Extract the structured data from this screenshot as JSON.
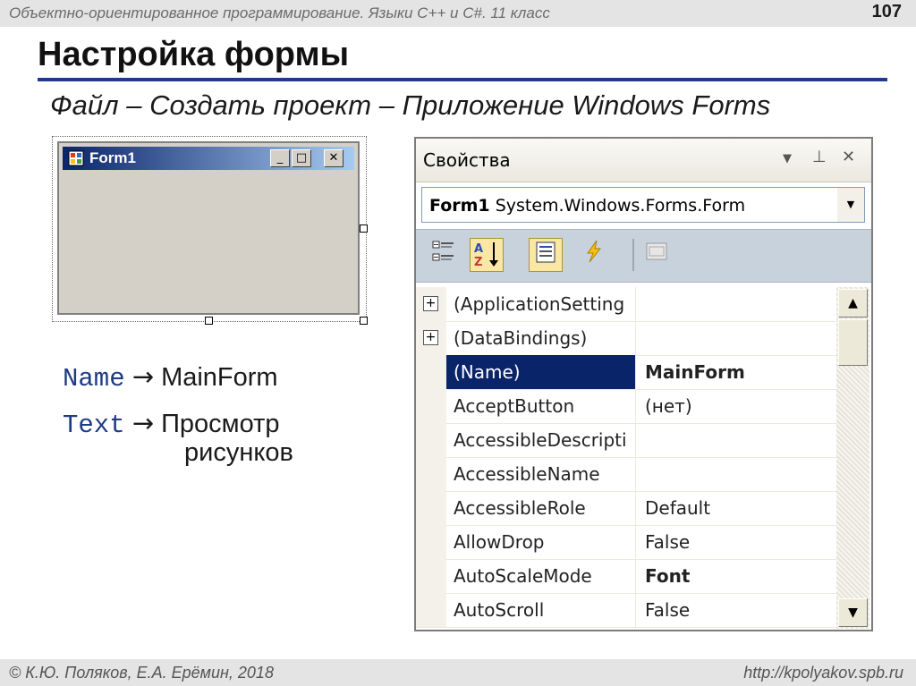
{
  "header": {
    "course": "Объектно-ориентированное программирование. Языки C++ и C#. 11 класс",
    "page_number": "107"
  },
  "slide": {
    "title": "Настройка формы",
    "subtitle": "Файл – Создать проект – Приложение Windows Forms"
  },
  "designer_form": {
    "title": "Form1",
    "icon": "form-window-icon",
    "buttons": {
      "minimize": "_",
      "maximize": "□",
      "close": "✕"
    }
  },
  "settings": [
    {
      "key": "Name",
      "arrow": "→",
      "value": "MainForm"
    },
    {
      "key": "Text",
      "arrow": "→",
      "value_line1": "Просмотр",
      "value_line2": "рисунков"
    }
  ],
  "properties": {
    "title": "Свойства",
    "header_buttons": {
      "dropdown": "▼",
      "pin": "⊥",
      "close": "✕"
    },
    "object_name": "Form1",
    "object_type": "System.Windows.Forms.Form",
    "toolbar": [
      "categorized-icon",
      "alphabetical-icon",
      "properties-icon",
      "events-icon",
      "property-pages-icon"
    ],
    "rows": [
      {
        "name": "(ApplicationSetting",
        "value": "",
        "expandable": true
      },
      {
        "name": "(DataBindings)",
        "value": "",
        "expandable": true
      },
      {
        "name": "(Name)",
        "value": "MainForm",
        "selected": true,
        "bold": true
      },
      {
        "name": "AcceptButton",
        "value": "(нет)"
      },
      {
        "name": "AccessibleDescripti",
        "value": ""
      },
      {
        "name": "AccessibleName",
        "value": ""
      },
      {
        "name": "AccessibleRole",
        "value": "Default"
      },
      {
        "name": "AllowDrop",
        "value": "False"
      },
      {
        "name": "AutoScaleMode",
        "value": "Font",
        "bold": true
      },
      {
        "name": "AutoScroll",
        "value": "False"
      }
    ]
  },
  "footer": {
    "authors": "© К.Ю. Поляков, Е.А. Ерёмин, 2018",
    "url": "http://kpolyakov.spb.ru"
  },
  "colors": {
    "title_rule": "#1f3b84",
    "selection": "#0a246a",
    "code_keyword": "#1f3b84"
  }
}
